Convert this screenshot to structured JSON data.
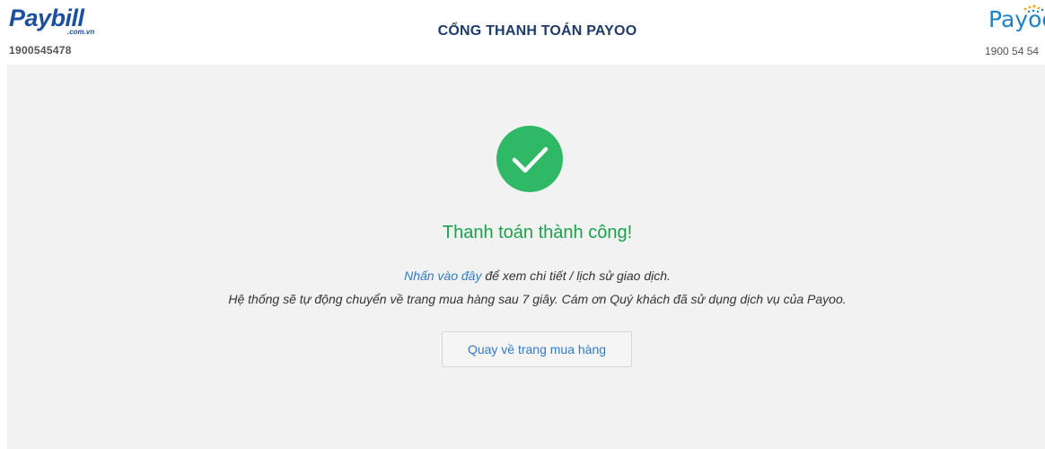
{
  "header": {
    "left_logo_text": "Paybill",
    "left_logo_sub": ".com.vn",
    "left_phone": "1900545478",
    "title": "CỔNG THANH TOÁN PAYOO",
    "right_logo_text": "Payoo",
    "right_phone": "1900 54 54"
  },
  "result": {
    "icon": "check-circle-icon",
    "message": "Thanh toán thành công!",
    "link_text": "Nhấn vào đây",
    "link_suffix": " để xem chi tiết / lịch sử giao dịch.",
    "redirect_note": "Hệ thống sẽ tự động chuyển về trang mua hàng sau 7 giây. Cám ơn Quý khách đã sử dụng dịch vụ của Payoo.",
    "back_button": "Quay về trang mua hàng"
  },
  "colors": {
    "success": "#1aa14a",
    "check_bg": "#2fb865",
    "link": "#2e7ad1",
    "brand_dark": "#1c4fa0",
    "payoo_blue": "#1d83c6",
    "content_bg": "#f2f2f2"
  }
}
